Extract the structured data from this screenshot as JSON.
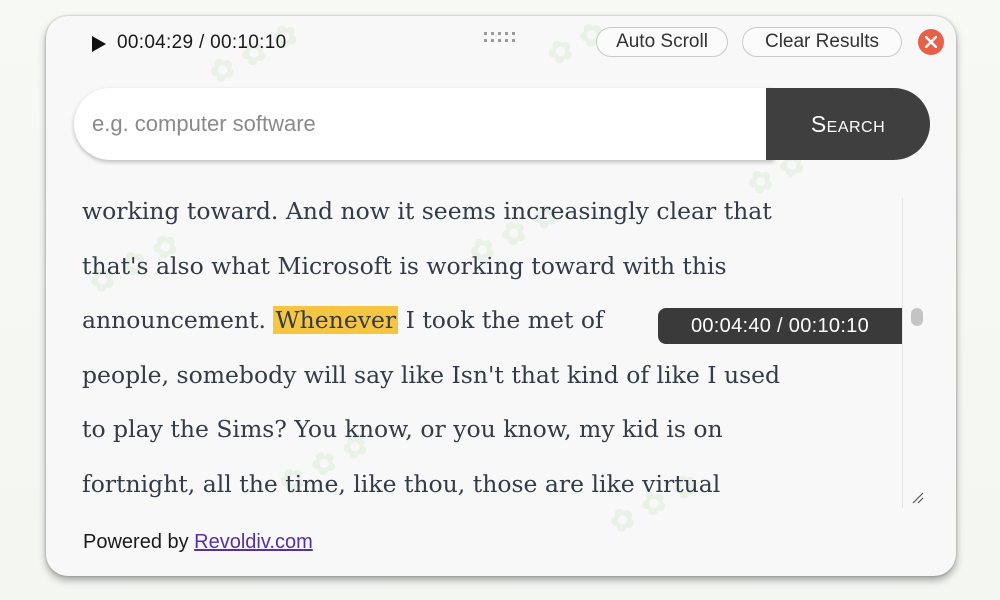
{
  "player": {
    "time_display": "00:04:29 / 00:10:10",
    "play_icon": "play-icon"
  },
  "toolbar": {
    "auto_scroll_label": "Auto Scroll",
    "clear_results_label": "Clear Results",
    "close_icon": "close-icon"
  },
  "search": {
    "placeholder": "e.g. computer software",
    "value": "",
    "button_label": "Search"
  },
  "transcript": {
    "lines": [
      "working toward. And now it seems increasingly clear that",
      "that's also what Microsoft is working toward with this",
      "announcement. ",
      "people, somebody will say like Isn't that kind of like I used",
      "to play the Sims? You know, or you know, my kid is on",
      "fortnight, all the time, like thou, those are like virtual"
    ],
    "highlight_word": "Whenever",
    "line3_rest": " I took the met of",
    "hover_time": "00:04:40 / 00:10:10"
  },
  "footer": {
    "powered_prefix": "Powered by ",
    "powered_link": "Revoldiv.com"
  },
  "colors": {
    "accent_dark": "#3f3f3f",
    "highlight": "#f6c542",
    "close": "#e8604a",
    "link": "#5a2fa0"
  }
}
